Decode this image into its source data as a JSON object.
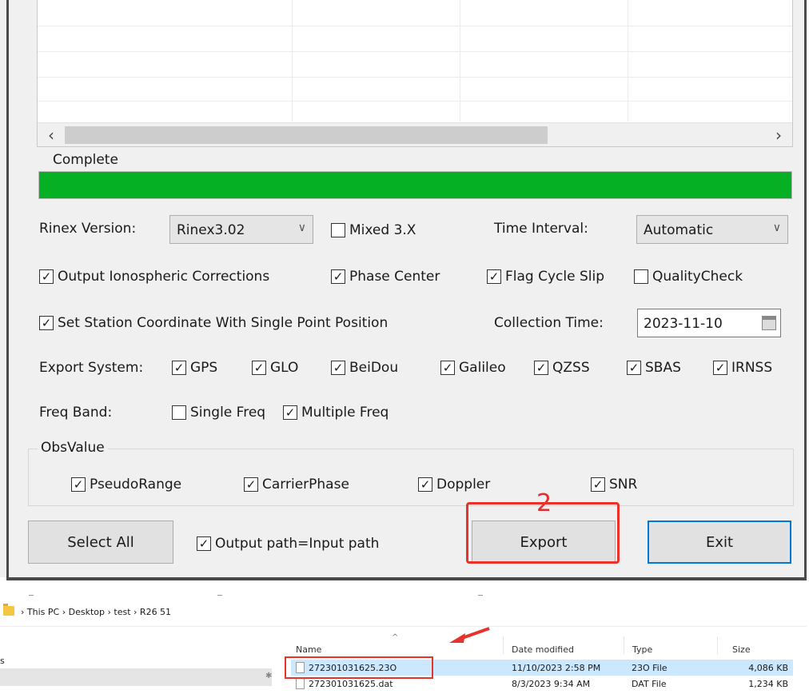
{
  "progress": {
    "label": "Complete",
    "fraction": 1.0,
    "color": "#06b025"
  },
  "rinex": {
    "label": "Rinex Version:",
    "value": "Rinex3.02"
  },
  "mixed": {
    "label": "Mixed 3.X",
    "checked": false
  },
  "time_interval": {
    "label": "Time Interval:",
    "value": "Automatic"
  },
  "options_row1": [
    {
      "label": "Output Ionospheric Corrections",
      "checked": true
    },
    {
      "label": "Phase Center",
      "checked": true
    },
    {
      "label": "Flag Cycle Slip",
      "checked": true
    },
    {
      "label": "QualityCheck",
      "checked": false
    }
  ],
  "station": {
    "label": "Set Station Coordinate With Single Point Position",
    "checked": true
  },
  "collection": {
    "label": "Collection Time:",
    "value": "2023-11-10"
  },
  "export_system": {
    "label": "Export System:",
    "items": [
      {
        "label": "GPS",
        "checked": true
      },
      {
        "label": "GLO",
        "checked": true
      },
      {
        "label": "BeiDou",
        "checked": true
      },
      {
        "label": "Galileo",
        "checked": true
      },
      {
        "label": "QZSS",
        "checked": true
      },
      {
        "label": "SBAS",
        "checked": true
      },
      {
        "label": "IRNSS",
        "checked": true
      }
    ]
  },
  "freq": {
    "label": "Freq Band:",
    "items": [
      {
        "label": "Single Freq",
        "checked": false
      },
      {
        "label": "Multiple Freq",
        "checked": true
      }
    ]
  },
  "obsvalue": {
    "title": "ObsValue",
    "items": [
      {
        "label": "PseudoRange",
        "checked": true
      },
      {
        "label": "CarrierPhase",
        "checked": true
      },
      {
        "label": "Doppler",
        "checked": true
      },
      {
        "label": "SNR",
        "checked": true
      }
    ]
  },
  "buttons": {
    "select_all": "Select All",
    "output_path": {
      "label": "Output path=Input path",
      "checked": true
    },
    "export": "Export",
    "exit": "Exit"
  },
  "annotation": {
    "step": "2",
    "color": "#e8322c"
  },
  "explorer": {
    "breadcrumb": [
      "This PC",
      "Desktop",
      "test",
      "R26 51"
    ],
    "columns": [
      "Name",
      "Date modified",
      "Type",
      "Size"
    ],
    "nav_partial": "s",
    "files": [
      {
        "name": "272301031625.23O",
        "date": "11/10/2023 2:58 PM",
        "type": "23O File",
        "size": "4,086 KB",
        "selected": true
      },
      {
        "name": "272301031625.dat",
        "date": "8/3/2023 9:34 AM",
        "type": "DAT File",
        "size": "1,234 KB",
        "selected": false
      }
    ]
  }
}
